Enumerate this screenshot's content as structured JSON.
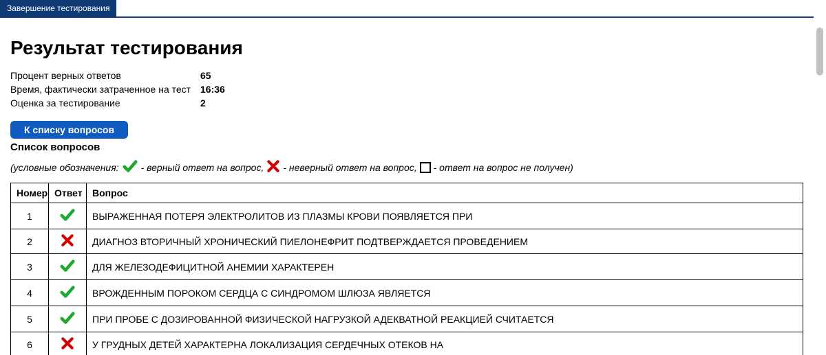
{
  "tab": {
    "label": "Завершение тестирования"
  },
  "page": {
    "title": "Результат тестирования"
  },
  "stats": {
    "rows": [
      {
        "label": "Процент верных ответов",
        "value": "65"
      },
      {
        "label": "Время, фактически затраченное на тест",
        "value": "16:36"
      },
      {
        "label": "Оценка за тестирование",
        "value": "2"
      }
    ]
  },
  "button": {
    "to_list": "К списку вопросов"
  },
  "section": {
    "questions_title": "Список вопросов"
  },
  "legend": {
    "prefix": "(условные обозначения:",
    "correct": " - верный ответ на вопрос,",
    "wrong": " - неверный ответ на вопрос,",
    "empty": " - ответ на вопрос не получен)"
  },
  "table": {
    "headers": {
      "num": "Номер",
      "ans": "Ответ",
      "q": "Вопрос"
    },
    "rows": [
      {
        "num": "1",
        "status": "correct",
        "q": "ВЫРАЖЕННАЯ ПОТЕРЯ ЭЛЕКТРОЛИТОВ ИЗ ПЛАЗМЫ КРОВИ ПОЯВЛЯЕТСЯ ПРИ"
      },
      {
        "num": "2",
        "status": "wrong",
        "q": "ДИАГНОЗ ВТОРИЧНЫЙ ХРОНИЧЕСКИЙ ПИЕЛОНЕФРИТ ПОДТВЕРЖДАЕТСЯ ПРОВЕДЕНИЕМ"
      },
      {
        "num": "3",
        "status": "correct",
        "q": "ДЛЯ ЖЕЛЕЗОДЕФИЦИТНОЙ АНЕМИИ ХАРАКТЕРЕН"
      },
      {
        "num": "4",
        "status": "correct",
        "q": "ВРОЖДЕННЫМ ПОРОКОМ СЕРДЦА С СИНДРОМОМ ШЛЮЗА ЯВЛЯЕТСЯ"
      },
      {
        "num": "5",
        "status": "correct",
        "q": "ПРИ ПРОБЕ С ДОЗИРОВАННОЙ ФИЗИЧЕСКОЙ НАГРУЗКОЙ АДЕКВАТНОЙ РЕАКЦИЕЙ СЧИТАЕТСЯ"
      },
      {
        "num": "6",
        "status": "wrong",
        "q": "У ГРУДНЫХ ДЕТЕЙ ХАРАКТЕРНА ЛОКАЛИЗАЦИЯ СЕРДЕЧНЫХ ОТЕКОВ НА"
      }
    ]
  },
  "icons": {
    "check": "check-icon",
    "cross": "cross-icon",
    "empty": "empty-box-icon"
  }
}
